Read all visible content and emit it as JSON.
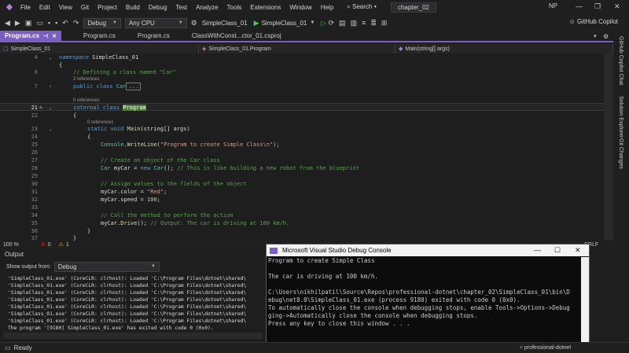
{
  "menubar": {
    "items": [
      "File",
      "Edit",
      "View",
      "Git",
      "Project",
      "Build",
      "Debug",
      "Test",
      "Analyze",
      "Tools",
      "Extensions",
      "Window",
      "Help"
    ],
    "search_label": "Search",
    "solution_name": "chapter_02",
    "avatar_initials": "NP"
  },
  "toolbar": {
    "config": "Debug",
    "platform": "Any CPU",
    "startup_project": "SimpleClass_01",
    "run_label": "SimpleClass_01",
    "copilot_label": "GitHub Copilot"
  },
  "tabs": [
    {
      "label": "Program.cs",
      "active": true
    },
    {
      "label": "Program.cs",
      "active": false
    },
    {
      "label": "Program.cs",
      "active": false
    },
    {
      "label": "ClassWithConst...ctor_01.csproj",
      "active": false
    }
  ],
  "navbar": {
    "project": "SimpleClass_01",
    "type": "SimpleClass_01.Program",
    "member": "Main(string[] args)"
  },
  "editor": {
    "refs_2": "2 references",
    "refs_0": "0 references",
    "refs_0b": "0 references",
    "line_numbers": [
      "4",
      "6",
      "7",
      "21",
      "22",
      "23",
      "24",
      "25",
      "26",
      "27",
      "28",
      "29",
      "30",
      "31",
      "32",
      "33",
      "34",
      "35",
      "36",
      "37"
    ],
    "code": {
      "l4_ns": "namespace",
      "l4_name": "SimpleClass_01",
      "l5": "{",
      "l6": "// Defining a class named \"Car\"",
      "l7_kw": "public class",
      "l7_name": "Car",
      "l7_collapsed": "...",
      "l21_kw": "internal class",
      "l21_name": "Program",
      "l22": "{",
      "l23_kw": "static void",
      "l23_fn": "Main",
      "l23_args": "(string[] args)",
      "l24": "{",
      "l25_obj": "Console",
      "l25_fn": "WriteLine",
      "l25_str": "\"Program to create Simple Class\\n\"",
      "l27": "// Create an object of the Car class",
      "l28_type": "Car",
      "l28_var": "myCar",
      "l28_new": "new",
      "l28_ctor": "Car",
      "l28_cm": "// This is like building a new robot from the blueprint",
      "l30": "// Assign values to the fields of the object",
      "l31_var": "myCar",
      "l31_field": ".color = ",
      "l31_str": "\"Red\"",
      "l32_var": "myCar",
      "l32_field": ".speed = ",
      "l32_num": "100",
      "l34": "// Call the method to perform the action",
      "l35_var": "myCar",
      "l35_fn": ".Drive",
      "l35_cm": "// Output: The car is driving at 100 km/h.",
      "l36": "}",
      "l37": "}"
    }
  },
  "editor_status": {
    "zoom": "100 %",
    "errors": "0",
    "warnings": "1",
    "encoding": "CRLF"
  },
  "right_panel": {
    "items": [
      "GitHub Copilot Chat",
      "Solution Explorer",
      "Git Changes"
    ]
  },
  "output": {
    "title": "Output",
    "show_from_label": "Show output from:",
    "show_from_value": "Debug",
    "lines": [
      "'SimpleClass_01.exe' (CoreCLR: clrhost): Loaded 'C:\\Program Files\\dotnet\\shared\\",
      "'SimpleClass_01.exe' (CoreCLR: clrhost): Loaded 'C:\\Program Files\\dotnet\\shared\\",
      "'SimpleClass_01.exe' (CoreCLR: clrhost): Loaded 'C:\\Program Files\\dotnet\\shared\\",
      "'SimpleClass_01.exe' (CoreCLR: clrhost): Loaded 'C:\\Program Files\\dotnet\\shared\\",
      "'SimpleClass_01.exe' (CoreCLR: clrhost): Loaded 'C:\\Program Files\\dotnet\\shared\\",
      "'SimpleClass_01.exe' (CoreCLR: clrhost): Loaded 'C:\\Program Files\\dotnet\\shared\\",
      "'SimpleClass_01.exe' (CoreCLR: clrhost): Loaded 'C:\\Program Files\\dotnet\\shared\\",
      "The program '[9180] SimpleClass_01.exe' has exited with code 0 (0x0)."
    ]
  },
  "console": {
    "title": "Microsoft Visual Studio Debug Console",
    "lines": [
      "Program to create Simple Class",
      "",
      "The car is driving at 100 km/h.",
      "",
      "C:\\Users\\nikhilpatil\\Source\\Repos\\professional-dotnet\\chapter_02\\SimpleClass_01\\bin\\D",
      "ebug\\net8.0\\SimpleClass_01.exe (process 9180) exited with code 0 (0x0).",
      "To automatically close the console when debugging stops, enable Tools->Options->Debug",
      "ging->Automatically close the console when debugging stops.",
      "Press any key to close this window . . ."
    ]
  },
  "statusbar": {
    "ready": "Ready",
    "branch": "professional-dotnet"
  }
}
